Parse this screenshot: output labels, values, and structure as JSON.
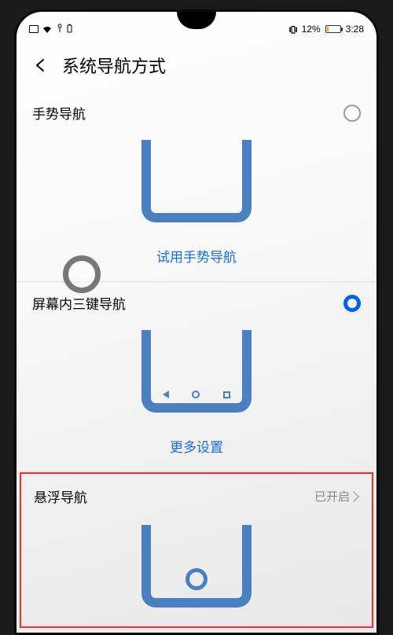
{
  "status_bar": {
    "vibration_icon": "vibration-icon",
    "battery_pct": "12%",
    "time": "3:28"
  },
  "header": {
    "title": "系统导航方式"
  },
  "options": {
    "gesture": {
      "label": "手势导航",
      "selected": false,
      "try_link": "试用手势导航"
    },
    "three_key": {
      "label": "屏幕内三键导航",
      "selected": true,
      "more_link": "更多设置"
    },
    "floating": {
      "label": "悬浮导航",
      "status_value": "已开启"
    }
  },
  "colors": {
    "accent": "#0066e0",
    "link": "#1a6dd8",
    "illustration": "#4a80c0",
    "highlight": "#ff2b2b"
  }
}
